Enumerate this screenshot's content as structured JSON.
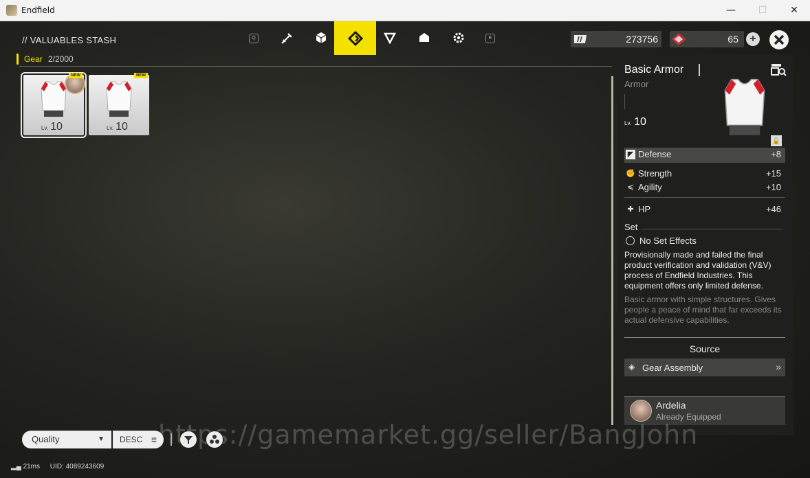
{
  "window": {
    "title": "Endfield",
    "minimize": "—",
    "maximize": "☐",
    "close": "✕"
  },
  "header": {
    "title": "// VALUABLES STASH",
    "tabs": [
      {
        "key": "Q"
      },
      {
        "icon": "weapon-icon"
      },
      {
        "icon": "cube-icon"
      },
      {
        "icon": "gear-diamond-icon",
        "active": true
      },
      {
        "icon": "triangle-icon"
      },
      {
        "icon": "box-icon"
      },
      {
        "icon": "cog-icon"
      },
      {
        "key": "E"
      }
    ],
    "currency1": "273756",
    "currency2": "65"
  },
  "category": {
    "label": "Gear",
    "count": "2/2000"
  },
  "items": [
    {
      "level_prefix": "Lv.",
      "level": "10",
      "tag": "NEW"
    },
    {
      "level_prefix": "Lv.",
      "level": "10",
      "tag": "NEW"
    }
  ],
  "detail": {
    "name": "Basic Armor",
    "type": "Armor",
    "level_prefix": "Lv.",
    "level": "10",
    "main_stat": {
      "name": "Defense",
      "value": "+8"
    },
    "stats": [
      {
        "name": "Strength",
        "value": "+15"
      },
      {
        "name": "Agility",
        "value": "+10"
      }
    ],
    "hp": {
      "name": "HP",
      "value": "+46"
    },
    "set_label": "Set",
    "set_effect": "No Set Effects",
    "description": "Provisionally made and failed the final product verification and validation (V&V) process of Endfield Industries. This equipment offers only limited defense.",
    "flavor": "Basic armor with simple structures. Gives people a peace of mind that far exceeds its actual defensive capabilities.",
    "source_heading": "Source",
    "source": "Gear Assembly",
    "equipped_name": "Ardelia",
    "equipped_status": "Already Equipped"
  },
  "sort": {
    "quality": "Quality",
    "order": "DESC"
  },
  "watermark": "https://gamemarket.gg/seller/BangJohn",
  "footer": {
    "ping": "21ms",
    "uid": "UID: 4089243609"
  }
}
